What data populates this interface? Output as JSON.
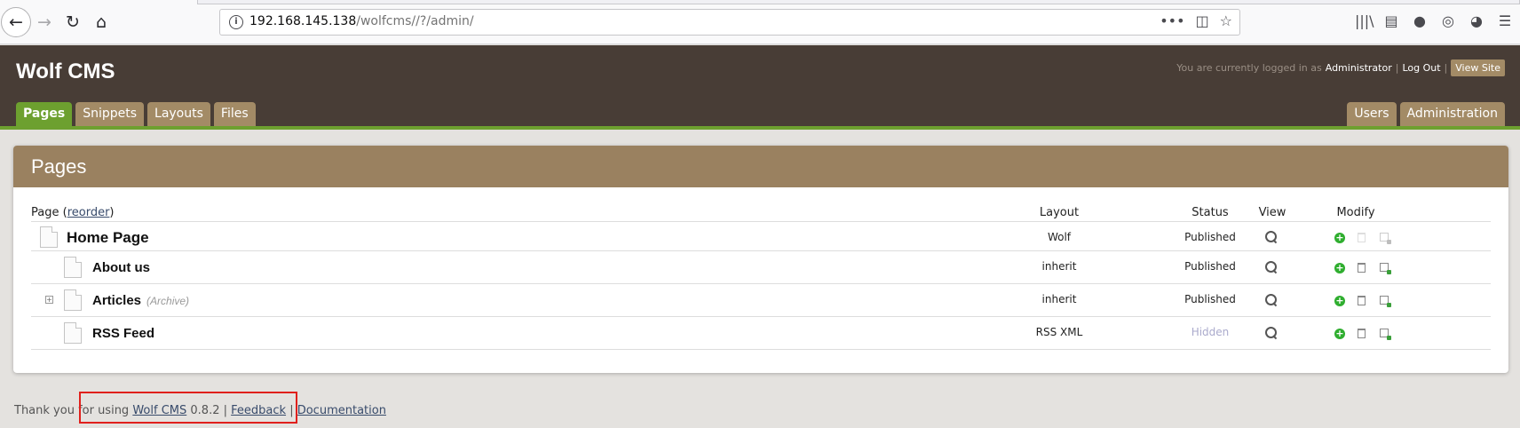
{
  "browser": {
    "url_host": "192.168.145.138",
    "url_path": "/wolfcms//?/admin/",
    "back_icon": "arrow-left-icon",
    "forward_icon": "arrow-right-icon",
    "reload_icon": "reload-icon",
    "home_icon": "home-icon",
    "more_icon": "•••",
    "pocket_icon": "◫",
    "bookmark_icon": "☆",
    "library_icon": "|||\\",
    "sidebar_icon": "▤",
    "extension1_icon": "●",
    "extension2_icon": "◎",
    "extension3_icon": "◕",
    "menu_icon": "☰"
  },
  "header": {
    "site_title": "Wolf CMS",
    "logged_in_text": "You are currently logged in as",
    "user": "Administrator",
    "logout": "Log Out",
    "view_site": "View Site",
    "tabs_left": [
      "Pages",
      "Snippets",
      "Layouts",
      "Files"
    ],
    "tabs_right": [
      "Users",
      "Administration"
    ]
  },
  "panel": {
    "title": "Pages",
    "columns": {
      "page": "Page (",
      "reorder": "reorder",
      "page_close": ")",
      "layout": "Layout",
      "status": "Status",
      "view": "View",
      "modify": "Modify"
    },
    "rows": [
      {
        "title": "Home Page",
        "archive": "",
        "layout": "Wolf",
        "status": "Published"
      },
      {
        "title": "About us",
        "archive": "",
        "layout": "inherit",
        "status": "Published"
      },
      {
        "title": "Articles",
        "archive": "(Archive)",
        "layout": "inherit",
        "status": "Published"
      },
      {
        "title": "RSS Feed",
        "archive": "",
        "layout": "RSS XML",
        "status": "Hidden"
      }
    ]
  },
  "footer": {
    "thank_you": "Thank you for using",
    "link_cms": "Wolf CMS",
    "version": "0.8.2 |",
    "link_feedback": "Feedback",
    "sep": "|",
    "link_docs": "Documentation"
  },
  "colors": {
    "header_bg": "#483d36",
    "tab_active": "#6da02f",
    "tab": "#a38b66",
    "panel_title_bg": "#9a8160",
    "highlight": "#e0201c"
  }
}
